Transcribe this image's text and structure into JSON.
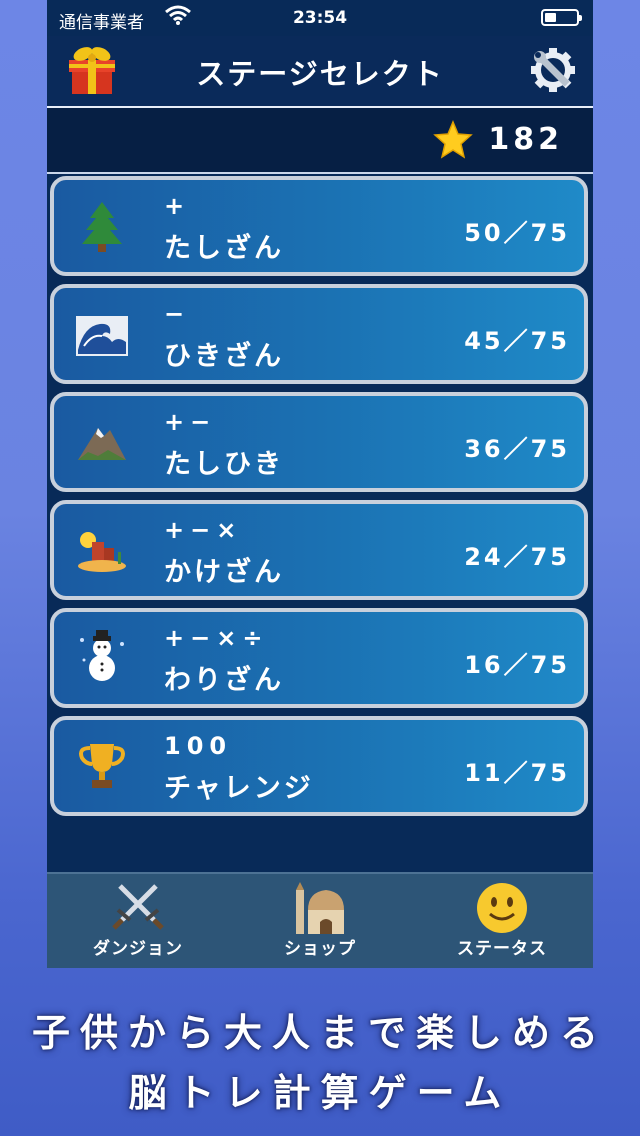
{
  "status": {
    "carrier": "通信事業者",
    "time": "23:54",
    "battery_level": 0.35
  },
  "header": {
    "title": "ステージセレクト",
    "left_icon": "gift-icon",
    "right_icon": "gear-wrench-icon"
  },
  "score": {
    "icon": "star-icon",
    "value": "182"
  },
  "stages": [
    {
      "icon": "🌲",
      "icon_name": "tree-icon",
      "ops": "+",
      "name": "たしざん",
      "progress": "50／75"
    },
    {
      "icon": "🌊",
      "icon_name": "wave-icon",
      "ops": "−",
      "name": "ひきざん",
      "progress": "45／75"
    },
    {
      "icon": "⛰",
      "icon_name": "mountain-icon",
      "ops": "+−",
      "name": "たしひき",
      "progress": "36／75"
    },
    {
      "icon": "🏜",
      "icon_name": "desert-icon",
      "ops": "+−×",
      "name": "かけざん",
      "progress": "24／75"
    },
    {
      "icon": "☃",
      "icon_name": "snowman-icon",
      "ops": "+−×÷",
      "name": "わりざん",
      "progress": "16／75"
    },
    {
      "icon": "🏆",
      "icon_name": "trophy-icon",
      "ops": "100",
      "name": "チャレンジ",
      "progress": "11／75"
    }
  ],
  "tabs": [
    {
      "label": "ダンジョン",
      "icon": "crossed-swords-icon"
    },
    {
      "label": "ショップ",
      "icon": "mosque-icon"
    },
    {
      "label": "ステータス",
      "icon": "smiley-icon"
    }
  ],
  "promo": {
    "line1": "子供から大人まで楽しめる",
    "line2": "脳トレ計算ゲーム"
  },
  "colors": {
    "panel": "#082a58",
    "card": "#1b73b4",
    "card_border": "#c8d0dc",
    "tabbar": "#2d5577"
  }
}
